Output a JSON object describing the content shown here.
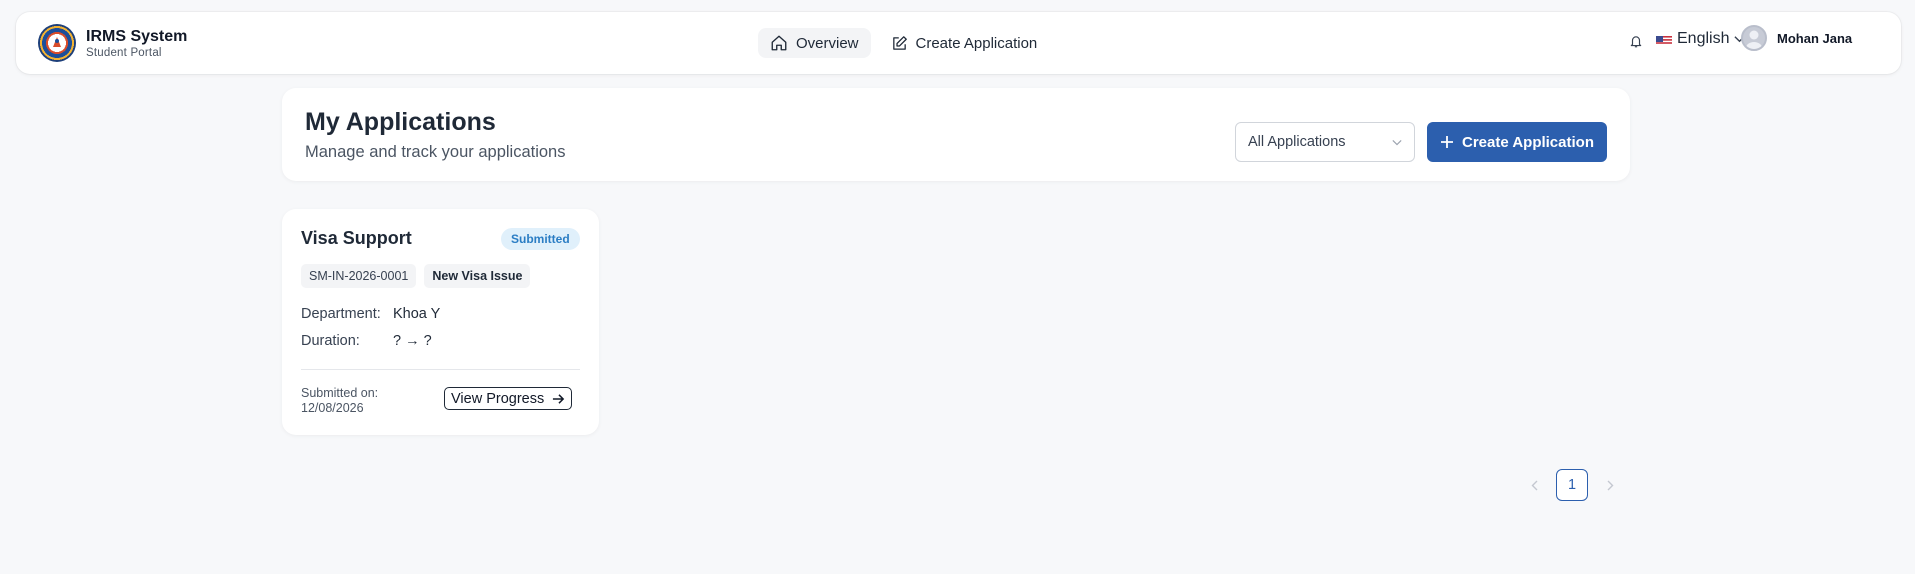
{
  "navbar": {
    "brand_title": "IRMS System",
    "brand_subtitle": "Student Portal",
    "links": [
      {
        "label": "Overview",
        "icon": "home-icon",
        "active": true
      },
      {
        "label": "Create Application",
        "icon": "edit-icon",
        "active": false
      }
    ],
    "language": "English",
    "user_name": "Mohan Jana"
  },
  "header": {
    "title": "My Applications",
    "subtitle": "Manage and track your applications",
    "filter_value": "All Applications",
    "create_label": "Create Application"
  },
  "application": {
    "title": "Visa Support",
    "status": "Submitted",
    "code": "SM-IN-2026-0001",
    "type": "New Visa Issue",
    "department_label": "Department:",
    "department_value": "Khoa Y",
    "duration_label": "Duration:",
    "duration_value": "? → ?",
    "submitted_label": "Submitted on:",
    "submitted_date": "12/08/2026",
    "action_label": "View Progress"
  },
  "pagination": {
    "current_page": "1"
  },
  "colors": {
    "primary": "#2c5fae",
    "badge_bg": "#e0f0fb",
    "badge_text": "#2b7dc4",
    "background": "#f7f8fa"
  }
}
